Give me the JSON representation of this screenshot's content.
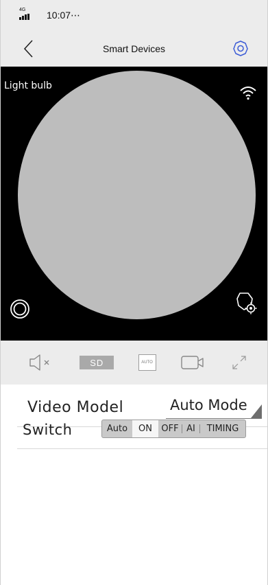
{
  "status_bar": {
    "network": "4G",
    "time": "10:07⋯"
  },
  "nav": {
    "title": "Smart Devices",
    "back_icon": "chevron-left-icon",
    "settings_icon": "gear-icon"
  },
  "video": {
    "device_name": "Light bulb",
    "icons": [
      "wifi-icon",
      "snapshot-icon",
      "ptz-settings-icon"
    ]
  },
  "toolbar": {
    "mute_icon": "speaker-mute-icon",
    "quality_label": "SD",
    "auto_label": "AUTO",
    "record_icon": "video-camera-icon",
    "fullscreen_icon": "expand-icon"
  },
  "settings": {
    "video_model": {
      "label": "Video Model",
      "value": "Auto Mode"
    },
    "switch": {
      "label": "Switch",
      "options": [
        "Auto",
        "ON",
        "OFF",
        "AI",
        "TIMING"
      ],
      "selected": "ON"
    }
  },
  "colors": {
    "bar_bg": "#ececec",
    "video_bg": "#000000",
    "preview": "#bdbdbd",
    "segment_bg": "#c9c9c9"
  }
}
